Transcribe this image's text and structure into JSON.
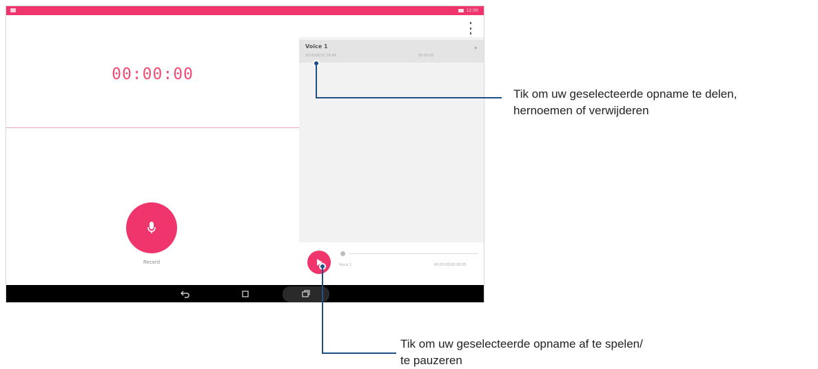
{
  "status_bar": {
    "time": "12:00"
  },
  "recorder": {
    "timer": "00:00:00",
    "record_label": "Record"
  },
  "recordings": {
    "items": [
      {
        "title": "Voice 1",
        "date": "2015/05/15 16:49",
        "duration": "00:00:05"
      }
    ]
  },
  "player": {
    "name": "Voice 1",
    "time": "00:00:00/00:00:05"
  },
  "callouts": {
    "share": {
      "line1": "Tik om uw geselecteerde opname te delen,",
      "line2": "hernoemen of verwijderen"
    },
    "play": {
      "line1": "Tik om uw geselecteerde opname af te spelen/",
      "line2": "te pauzeren"
    }
  },
  "colors": {
    "accent": "#f0356c",
    "callout_line": "#1d4f86"
  }
}
